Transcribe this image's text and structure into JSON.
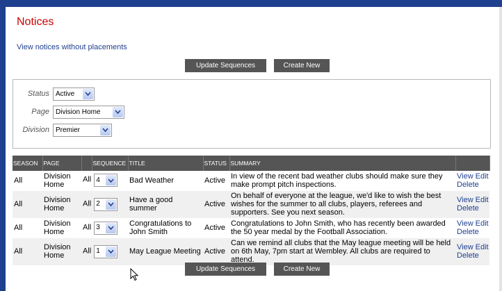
{
  "page_title": "Notices",
  "link_without_placements": "View notices without placements",
  "buttons": {
    "update_sequences": "Update Sequences",
    "create_new": "Create New"
  },
  "filters": {
    "status": {
      "label": "Status",
      "value": "Active"
    },
    "page": {
      "label": "Page",
      "value": "Division Home"
    },
    "division": {
      "label": "Division",
      "value": "Premier"
    }
  },
  "table": {
    "headers": [
      "SEASON",
      "PAGE",
      "",
      "SEQUENCE",
      "TITLE",
      "STATUS",
      "SUMMARY",
      ""
    ],
    "rows": [
      {
        "season": "All",
        "page": "Division Home",
        "all": "All",
        "sequence": "4",
        "title": "Bad Weather",
        "status": "Active",
        "summary": "In view of the recent bad weather clubs should make sure they make prompt pitch inspections.",
        "view": "View",
        "edit": "Edit",
        "delete": "Delete"
      },
      {
        "season": "All",
        "page": "Division Home",
        "all": "All",
        "sequence": "2",
        "title": "Have a good summer",
        "status": "Active",
        "summary": "On behalf of everyone at the league, we'd like to wish the best wishes for the summer to all clubs, players, referees and supporters. See you next season.",
        "view": "View",
        "edit": "Edit",
        "delete": "Delete"
      },
      {
        "season": "All",
        "page": "Division Home",
        "all": "All",
        "sequence": "3",
        "title": "Congratulations to John Smith",
        "status": "Active",
        "summary": "Congratulations to John Smith, who has recently been awarded the 50 year medal by the Football Association.",
        "view": "View",
        "edit": "Edit",
        "delete": "Delete"
      },
      {
        "season": "All",
        "page": "Division Home",
        "all": "All",
        "sequence": "1",
        "title": "May League Meeting",
        "status": "Active",
        "summary": "Can we remind all clubs that the May league meeting will be held on 6th May, 7pm start at Wembley. All clubs are required to attend.",
        "view": "View",
        "edit": "Edit",
        "delete": "Delete"
      }
    ]
  },
  "colors": {
    "title": "#cc0000",
    "link": "#1f3f8f",
    "header_bg": "#555555",
    "frame": "#1f3f8f"
  }
}
